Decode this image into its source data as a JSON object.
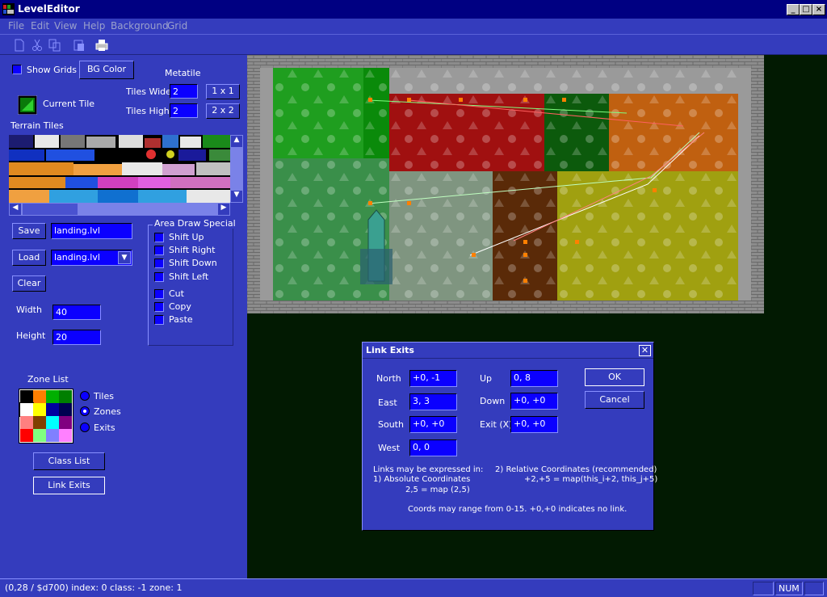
{
  "window": {
    "title": "LevelEditor"
  },
  "menu": [
    "File",
    "Edit",
    "View",
    "Help",
    "Background",
    "Grid"
  ],
  "toolbar": {
    "icons": [
      "new-icon",
      "cut-icon",
      "copy-icon",
      "paste-icon",
      "print-icon"
    ]
  },
  "left": {
    "show_grids": "Show Grids",
    "bg_color": "BG Color",
    "metatile": "Metatile",
    "tiles_wide_label": "Tiles Wide",
    "tiles_wide": "2",
    "tiles_high_label": "Tiles High",
    "tiles_high": "2",
    "btn_1x1": "1 x 1",
    "btn_2x2": "2 x 2",
    "current_tile": "Current Tile",
    "terrain_tiles": "Terrain Tiles",
    "save": "Save",
    "save_file": "landing.lvl",
    "load": "Load",
    "load_file": "landing.lvl",
    "clear": "Clear",
    "width_label": "Width",
    "width": "40",
    "height_label": "Height",
    "height": "20",
    "area_draw": {
      "title": "Area Draw Special",
      "items": [
        "Shift Up",
        "Shift Right",
        "Shift Down",
        "Shift Left",
        "Cut",
        "Copy",
        "Paste"
      ]
    },
    "zone_list": "Zone List",
    "zone_colors": [
      "#000000",
      "#ff7f00",
      "#00b000",
      "#007f00",
      "#ffffff",
      "#ffff00",
      "#0000a0",
      "#000050",
      "#ff8080",
      "#804000",
      "#00ffff",
      "#800080",
      "#ff0000",
      "#80ff80",
      "#8080ff",
      "#ff80ff"
    ],
    "radios": [
      "Tiles",
      "Zones",
      "Exits"
    ],
    "class_list": "Class List",
    "link_exits": "Link Exits"
  },
  "dialog": {
    "title": "Link Exits",
    "north_label": "North",
    "north": "+0, -1",
    "east_label": "East",
    "east": "3, 3",
    "south_label": "South",
    "south": "+0, +0",
    "west_label": "West",
    "west": "0, 0",
    "up_label": "Up",
    "up": "0, 8",
    "down_label": "Down",
    "down": "+0, +0",
    "exit_label": "Exit (X)",
    "exit": "+0, +0",
    "ok": "OK",
    "cancel": "Cancel",
    "help1": "Links may be expressed in:",
    "help2": "1) Absolute Coordinates",
    "help3": "2,5 = map (2,5)",
    "help4": "2) Relative Coordinates (recommended)",
    "help5": "+2,+5 = map(this_i+2, this_j+5)",
    "help6": "Coords may range from 0-15.  +0,+0 indicates no link."
  },
  "status": {
    "text": "(0,28 / $d700)  index: 0  class: -1  zone:  1",
    "num": "NUM"
  }
}
